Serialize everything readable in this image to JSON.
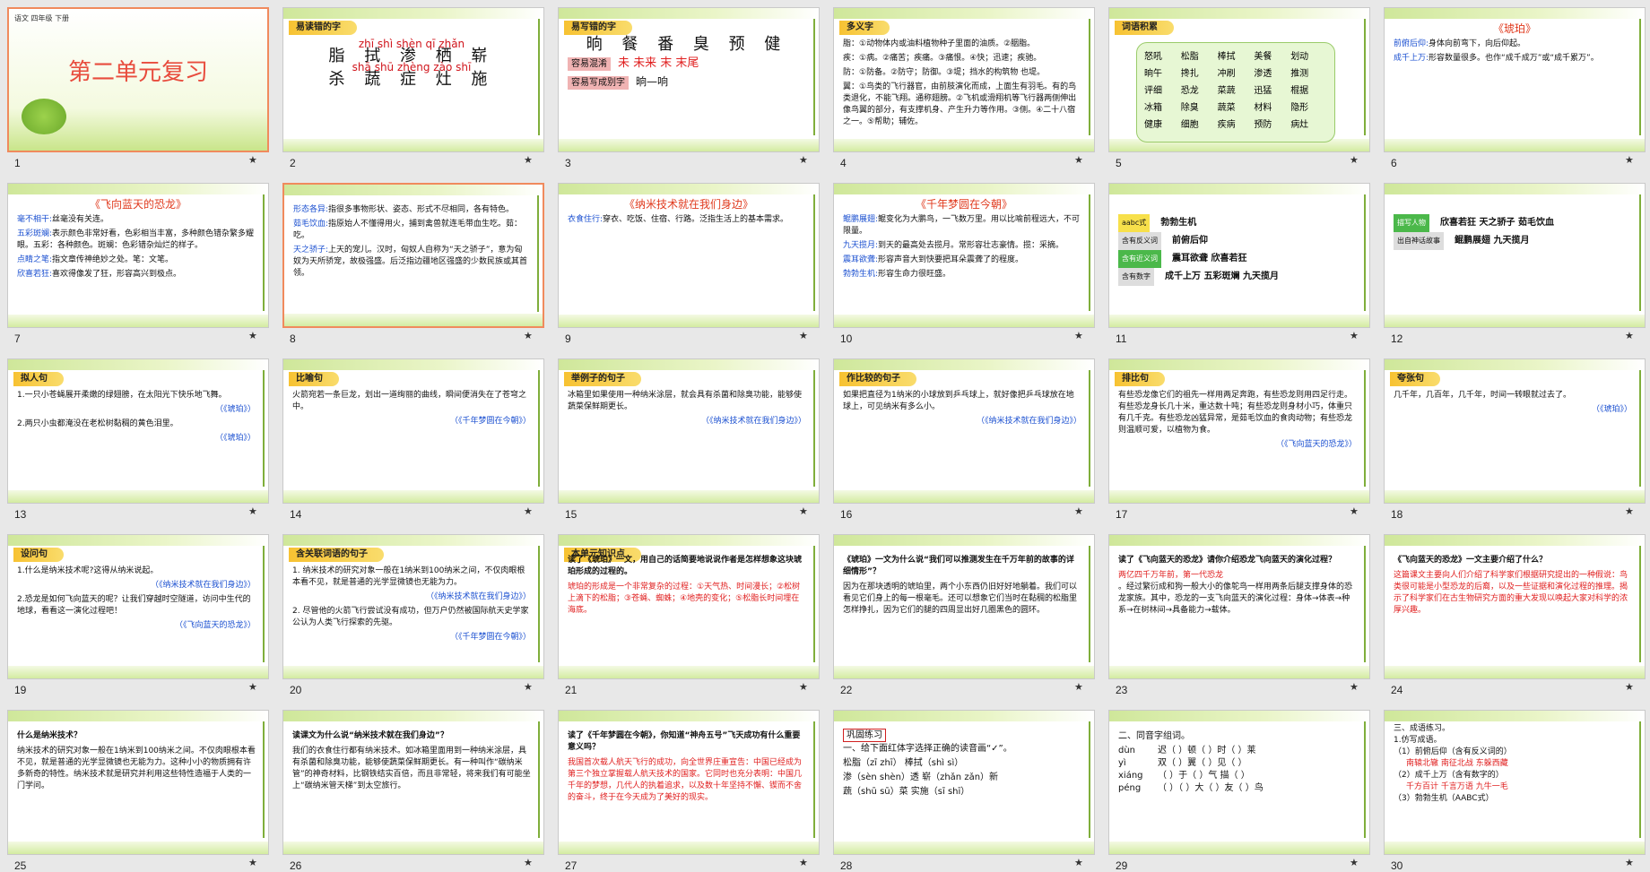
{
  "slides": [
    {
      "n": "1",
      "top": "语文  四年级  下册",
      "title": "第二单元复习"
    },
    {
      "n": "2",
      "header": "易读错的字",
      "pinyin1": "zhī   shì   shèn   qī   zhǎn",
      "chars1": "脂  拭  渗  栖  崭",
      "pinyin2": "shā   shū   zhèng   zào   shī",
      "chars2": "杀  蔬  症  灶  施"
    },
    {
      "n": "3",
      "header": "易写错的字",
      "chars": "晌 餐 番 臭 预 健",
      "row2_label": "容易混淆",
      "row2": "未 未来   末 末尾",
      "row3_label": "容易写成别字",
      "row3": "晌—响"
    },
    {
      "n": "4",
      "header": "多义字",
      "l1": "脂：①动物体内或油料植物种子里面的油质。②胭脂。",
      "l2": "疾：①病。②痛苦；疾痛。③痛恨。④快；迅速；疾驰。",
      "l3": "防：①防备。②防守；防御。③堤；挡水的构筑物 也堤。",
      "l4": "翼：①鸟类的飞行器官，由前肢演化而成，上面生有羽毛。有的鸟类退化，不能飞翔。通称翅膀。②飞机或滑翔机等飞行器两侧伸出像鸟翼的部分，有支撑机身、产生升力等作用。③侧。④二十八宿之一。⑤帮助；辅佐。"
    },
    {
      "n": "5",
      "header": "词语积累",
      "words": [
        "怒吼",
        "松脂",
        "棒拭",
        "美餐",
        "划动",
        "晌午",
        "搀扎",
        "冲刷",
        "渗透",
        "推测",
        "评细",
        "恐龙",
        "菜蔬",
        "迅猛",
        "棍据",
        "冰箱",
        "除臭",
        "蔬菜",
        "材料",
        "隐形",
        "健康",
        "细胞",
        "疾病",
        "预防",
        "病灶"
      ]
    },
    {
      "n": "6",
      "title": "《琥珀》",
      "l1_k": "前俯后仰:",
      "l1": "身体向前弯下，向后仰起。",
      "l2_k": "成千上万:",
      "l2": "形容数量很多。也作“成千成万”或“成千累万”。"
    },
    {
      "n": "7",
      "title": "《飞向蓝天的恐龙》",
      "l1_k": "毫不相干:",
      "l1": "丝毫没有关连。",
      "l2_k": "五彩斑斓:",
      "l2": "表示颜色非常好看，色彩相当丰富，多种颜色错杂繁多耀眼。五彩：各种颜色。斑斓：色彩错杂灿烂的样子。",
      "l3_k": "点睛之笔:",
      "l3": "指文章传神绝妙之处。笔：文笔。",
      "l4_k": "欣喜若狂:",
      "l4": "喜欢得像发了狂，形容高兴到极点。"
    },
    {
      "n": "8",
      "l1_k": "形态各异:",
      "l1": "指很多事物形状、姿态、形式不尽相同，各有特色。",
      "l2_k": "茹毛饮血:",
      "l2": "指原始人不懂得用火，捕到禽兽就连毛带血生吃。茹：吃。",
      "l3_k": "天之骄子:",
      "l3": "上天的宠儿。汉时，匈奴人自称为“天之骄子”，意为匈奴为天所骄宠，故极强盛。后泛指边疆地区强盛的少数民族或其首领。"
    },
    {
      "n": "9",
      "title": "《纳米技术就在我们身边》",
      "l1_k": "衣食住行:",
      "l1": "穿衣、吃饭、住宿、行路。泛指生活上的基本需求。"
    },
    {
      "n": "10",
      "title": "《千年梦圆在今朝》",
      "l1_k": "鲲鹏展翅:",
      "l1": "鲲变化为大鹏鸟，一飞数万里。用以比喻前程远大，不可限量。",
      "l2_k": "九天揽月:",
      "l2": "到天的最高处去揽月。常形容壮志豪情。揽：采摘。",
      "l3_k": "震耳欲聋:",
      "l3": "形容声音大到快要把耳朵震聋了的程度。",
      "l4_k": "勃勃生机:",
      "l4": "形容生命力很旺盛。"
    },
    {
      "n": "11",
      "t1": "aabc式",
      "w1": "勃勃生机",
      "t2": "含有反义词",
      "w2": "前俯后仰",
      "t3": "含有近义词",
      "w3": "震耳欲聋    欣喜若狂",
      "t4": "含有数字",
      "w4": "成千上万   五彩斑斓   九天揽月"
    },
    {
      "n": "12",
      "t1": "描写人物",
      "w1": "欣喜若狂   天之骄子   茹毛饮血",
      "t2": "出自神话故事",
      "w2": "鲲鹏展翅   九天揽月"
    },
    {
      "n": "13",
      "header": "拟人句",
      "l1": "1.一只小苍蝇展开柔嫩的绿翅膀，在太阳光下快乐地飞舞。",
      "s1": "（《琥珀》）",
      "l2": "2.两只小虫都淹没在老松树黏稠的黄色泪里。",
      "s2": "（《琥珀》）"
    },
    {
      "n": "14",
      "header": "比喻句",
      "l1": "火箭宛若一条巨龙，划出一道绚丽的曲线，瞬间便消失在了苍穹之中。",
      "s1": "（《千年梦圆在今朝》）"
    },
    {
      "n": "15",
      "header": "举例子的句子",
      "l1": "冰箱里如果使用一种纳米涂层，就会具有杀菌和除臭功能，能够使蔬菜保鲜期更长。",
      "s1": "（《纳米技术就在我们身边》）"
    },
    {
      "n": "16",
      "header": "作比较的句子",
      "l1": "如果把直径为1纳米的小球放到乒乓球上，就好像把乒乓球放在地球上，可见纳米有多么小。",
      "s1": "（《纳米技术就在我们身边》）"
    },
    {
      "n": "17",
      "header": "排比句",
      "l1": "有些恐龙像它们的祖先一样用两足奔跑，有些恐龙则用四足行走。有些恐龙身长几十米，重达数十吨；有些恐龙则身材小巧，体重只有几千克。有些恐龙凶猛异常，是茹毛饮血的食肉动物；有些恐龙则温顺可爱，以植物为食。",
      "s1": "（《飞向蓝天的恐龙》）"
    },
    {
      "n": "18",
      "header": "夸张句",
      "l1": "几千年，几百年，几千年，时间一转眼就过去了。",
      "s1": "（《琥珀》）"
    },
    {
      "n": "19",
      "header": "设问句",
      "l1": "1.什么是纳米技术呢?这得从纳米说起。",
      "s1": "（《纳米技术就在我们身边》）",
      "l2": "2.恐龙是如何飞向蓝天的呢？让我们穿越时空隧道，访问中生代的地球，看看这一演化过程吧！",
      "s2": "（《飞向蓝天的恐龙》）"
    },
    {
      "n": "20",
      "header": "含关联词语的句子",
      "l1": "1. 纳米技术的研究对象一般在1纳米到100纳米之间，不仅肉眼根本看不见，就是普通的光学显微镜也无能为力。",
      "s1": "（《纳米技术就在我们身边》）",
      "l2": "2. 尽管他的火箭飞行尝试没有成功，但万户仍然被国际航天史学家公认为人类飞行探索的先驱。",
      "s2": "（《千年梦圆在今朝》）"
    },
    {
      "n": "21",
      "header": "本单元知识点",
      "q": "读了《琥珀》一文，用自己的话简要地说说作者是怎样想象这块琥珀形成的过程的。",
      "a": "琥珀的形成是一个非常复杂的过程：①天气热、时间漫长；②松树上滴下的松脂；③苍蝇、蜘蛛；④地壳的变化；⑤松脂长时间埋在海底。"
    },
    {
      "n": "22",
      "q": "《琥珀》一文为什么说“我们可以推测发生在千万年前的故事的详细情形”？",
      "a": "因为在那块透明的琥珀里，两个小东西仍旧好好地躺着。我们可以看见它们身上的每一根毫毛。还可以想象它们当时在黏稠的松脂里怎样挣扎，因为它们的腿的四周显出好几圈黑色的圆环。"
    },
    {
      "n": "23",
      "q": "读了《飞向蓝天的恐龙》请你介绍恐龙飞向蓝天的演化过程？",
      "a1": "两亿四千万年前，第一代恐龙",
      "a2": "。经过繁衍成和狗一般大小的像鸵鸟一样用两条后腿支撑身体的恐龙家族。其中，恐龙的一支飞向蓝天的演化过程：身体→体表→种系→在树林间→具备能力→载体。"
    },
    {
      "n": "24",
      "q": "《飞向蓝天的恐龙》一文主要介绍了什么？",
      "a": "这篇课文主要向人们介绍了科学家们根据研究提出的一种假说：鸟类很可能是小型恐龙的后裔，以及一些证据和演化过程的推理。揭示了科学家们在古生物研究方面的重大发现以唤起大家对科学的浓厚兴趣。"
    },
    {
      "n": "25",
      "q": "什么是纳米技术？",
      "a": "纳米技术的研究对象一般在1纳米到100纳米之间。不仅肉眼根本看不见，就是普通的光学显微镜也无能为力。这种小小的物质拥有许多新奇的特性。纳米技术就是研究并利用这些特性造福于人类的一门学问。"
    },
    {
      "n": "26",
      "q": "读课文为什么说“纳米技术就在我们身边”？",
      "a": "我们的衣食住行都有纳米技术。如冰箱里面用到一种纳米涂层，具有杀菌和除臭功能，能够使蔬菜保鲜期更长。有一种叫作“碳纳米管”的神奇材料，比钢铁结实百倍，而且非常轻，将来我们有可能坐上“碳纳米管天梯”到太空旅行。"
    },
    {
      "n": "27",
      "q": "读了《千年梦圆在今朝》，你知道“神舟五号”飞天成功有什么重要意义吗？",
      "a": "我国首次载人航天飞行的成功，向全世界庄重宣告：中国已经成为第三个独立掌握载人航天技术的国家。它同时也充分表明：中国几千年的梦想，几代人的执着追求，以及数十年坚持不懈、锲而不舍的奋斗，终于在今天成为了美好的现实。"
    },
    {
      "n": "28",
      "label": "巩固练习",
      "l1": "一、给下面红体字选择正确的读音画“✓”。",
      "l2": "松脂（zī zhī）   棒拭（shì sì）",
      "l3": "渗（sèn shèn）透   崭（zhǎn zǎn）新",
      "l4": "蔬（shū sū）菜   实施（sī shī）"
    },
    {
      "n": "29",
      "l1": "二、同音字组词。",
      "py": [
        "dùn",
        "yì",
        "xiáng",
        "péng"
      ],
      "r1": "迟（  ）顿（  ）时（  ）莱",
      "r2": "双（  ）翼（  ）见（  ）",
      "r3": "（  ）于（  ）气   描（  ）",
      "r4": "（  ）（  ）大（  ）友（  ）鸟"
    },
    {
      "n": "30",
      "l1": "三、成语练习。",
      "l2": "1.仿写成语。",
      "l3": "（1）前俯后仰（含有反义词的）",
      "l4": "南辕北辙   南征北战   东躲西藏",
      "l5": "（2）成千上万（含有数字的）",
      "l6": "千方百计   千言万语   九牛一毛",
      "l7": "（3）勃勃生机（AABC式）"
    }
  ]
}
